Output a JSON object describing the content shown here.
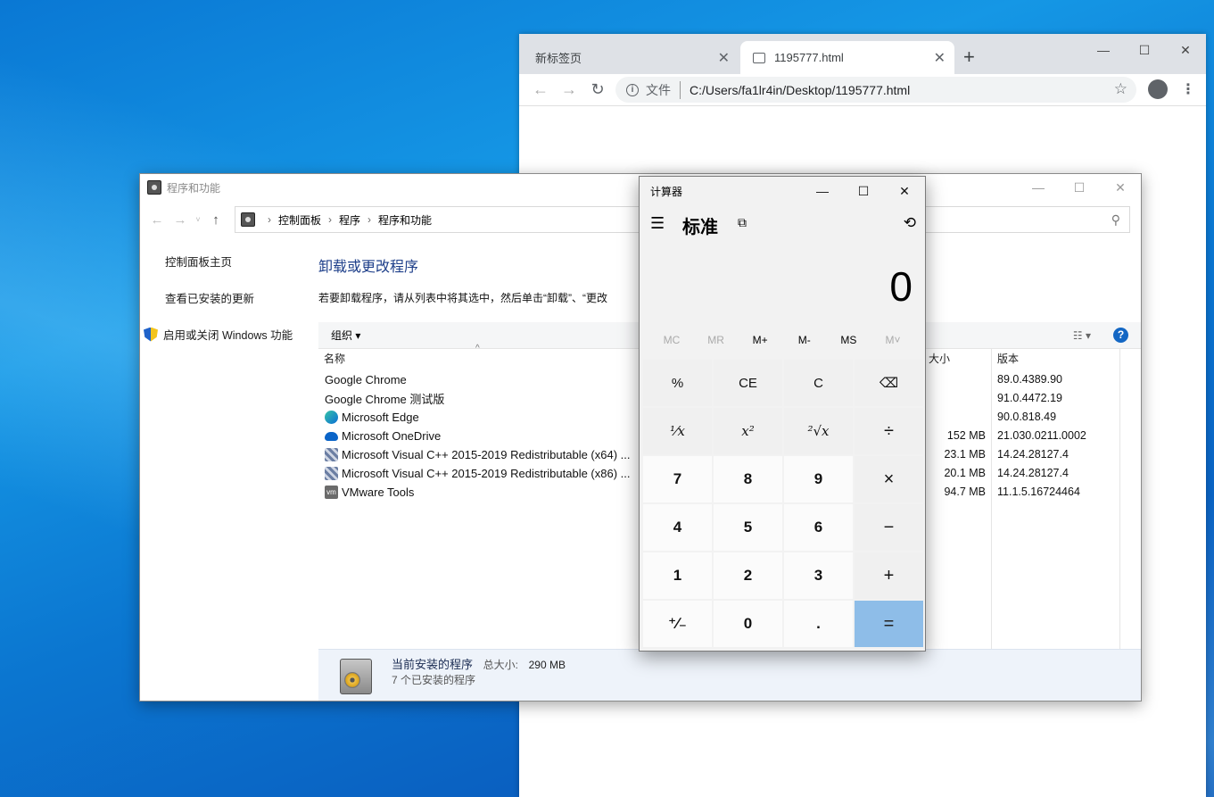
{
  "chrome": {
    "tabs": [
      {
        "label": "新标签页",
        "active": false
      },
      {
        "label": "1195777.html",
        "active": true
      }
    ],
    "new_tab": "+",
    "address_prefix": "文件",
    "address": "C:/Users/fa1lr4in/Desktop/1195777.html"
  },
  "programs": {
    "window_title": "程序和功能",
    "breadcrumb": [
      "控制面板",
      "程序",
      "程序和功能"
    ],
    "sidebar": {
      "home": "控制面板主页",
      "updates": "查看已安装的更新",
      "features": "启用或关闭 Windows 功能"
    },
    "heading": "卸载或更改程序",
    "description": "若要卸载程序，请从列表中将其选中，然后单击“卸载”、“更改",
    "toolbar_organize": "组织",
    "columns": {
      "name": "名称",
      "size": "大小",
      "version": "版本"
    },
    "items": [
      {
        "name": "Google Chrome",
        "size": "",
        "version": "89.0.4389.90",
        "icon": "chrome-icon"
      },
      {
        "name": "Google Chrome 测试版",
        "size": "",
        "version": "91.0.4472.19",
        "icon": "chrome-icon"
      },
      {
        "name": "Microsoft Edge",
        "size": "",
        "version": "90.0.818.49",
        "icon": "edge-icon"
      },
      {
        "name": "Microsoft OneDrive",
        "size": "152 MB",
        "version": "21.030.0211.0002",
        "icon": "onedrive-icon"
      },
      {
        "name": "Microsoft Visual C++ 2015-2019 Redistributable (x64) ...",
        "size": "23.1 MB",
        "version": "14.24.28127.4",
        "icon": "installer-icon"
      },
      {
        "name": "Microsoft Visual C++ 2015-2019 Redistributable (x86) ...",
        "size": "20.1 MB",
        "version": "14.24.28127.4",
        "icon": "installer-icon"
      },
      {
        "name": "VMware Tools",
        "size": "94.7 MB",
        "version": "11.1.5.16724464",
        "icon": "vmware-icon"
      }
    ],
    "status": {
      "title": "当前安装的程序",
      "total_label": "总大小:",
      "total": "290 MB",
      "count": "7 个已安装的程序"
    }
  },
  "calculator": {
    "title": "计算器",
    "mode": "标准",
    "display": "0",
    "memory": [
      {
        "label": "MC",
        "enabled": false
      },
      {
        "label": "MR",
        "enabled": false
      },
      {
        "label": "M+",
        "enabled": true
      },
      {
        "label": "M-",
        "enabled": true
      },
      {
        "label": "MS",
        "enabled": true
      },
      {
        "label": "M˅",
        "enabled": false
      }
    ],
    "keys": [
      {
        "label": "%",
        "kind": "fn",
        "name": "percent-key"
      },
      {
        "label": "CE",
        "kind": "fn",
        "name": "clear-entry-key"
      },
      {
        "label": "C",
        "kind": "fn",
        "name": "clear-key"
      },
      {
        "label": "⌫",
        "kind": "fn",
        "name": "backspace-key"
      },
      {
        "label": "¹⁄x",
        "kind": "fn italic",
        "name": "reciprocal-key"
      },
      {
        "label": "x²",
        "kind": "fn italic",
        "name": "square-key"
      },
      {
        "label": "²√x",
        "kind": "fn italic",
        "name": "sqrt-key"
      },
      {
        "label": "÷",
        "kind": "fn op",
        "name": "divide-key"
      },
      {
        "label": "7",
        "kind": "num",
        "name": "digit-7-key"
      },
      {
        "label": "8",
        "kind": "num",
        "name": "digit-8-key"
      },
      {
        "label": "9",
        "kind": "num",
        "name": "digit-9-key"
      },
      {
        "label": "×",
        "kind": "fn op",
        "name": "multiply-key"
      },
      {
        "label": "4",
        "kind": "num",
        "name": "digit-4-key"
      },
      {
        "label": "5",
        "kind": "num",
        "name": "digit-5-key"
      },
      {
        "label": "6",
        "kind": "num",
        "name": "digit-6-key"
      },
      {
        "label": "−",
        "kind": "fn op",
        "name": "subtract-key"
      },
      {
        "label": "1",
        "kind": "num",
        "name": "digit-1-key"
      },
      {
        "label": "2",
        "kind": "num",
        "name": "digit-2-key"
      },
      {
        "label": "3",
        "kind": "num",
        "name": "digit-3-key"
      },
      {
        "label": "+",
        "kind": "fn op",
        "name": "add-key"
      },
      {
        "label": "⁺∕₋",
        "kind": "num",
        "name": "negate-key"
      },
      {
        "label": "0",
        "kind": "num",
        "name": "digit-0-key"
      },
      {
        "label": ".",
        "kind": "num",
        "name": "decimal-key"
      },
      {
        "label": "=",
        "kind": "eq",
        "name": "equals-key"
      }
    ]
  },
  "colors": {
    "desktop": "#0a78d4",
    "equals_key": "#8ebde8",
    "link_heading": "#1e3f8a"
  }
}
